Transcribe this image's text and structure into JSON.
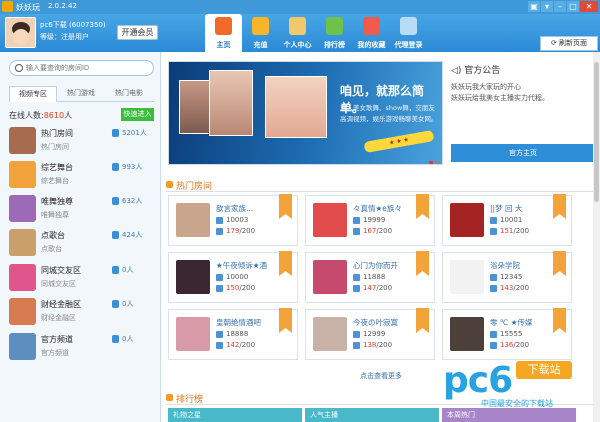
{
  "window": {
    "app_name": "妖妖玩",
    "version": "2.0.2.42"
  },
  "user": {
    "name": "pc6下载 (6007350)",
    "level": "等级：注册用户",
    "vip_button": "开通会员"
  },
  "nav": [
    {
      "label": "主页",
      "icon": "home-icon",
      "color": "#f26a2a"
    },
    {
      "label": "充值",
      "icon": "coins-icon",
      "color": "#f6b52b"
    },
    {
      "label": "个人中心",
      "icon": "person-icon",
      "color": "#f2c86a"
    },
    {
      "label": "排行榜",
      "icon": "bar-chart-icon",
      "color": "#6cc24a"
    },
    {
      "label": "我的收藏",
      "icon": "heart-icon",
      "color": "#ef5c4c"
    },
    {
      "label": "代理登录",
      "icon": "monitor-icon",
      "color": "#b9dcf4"
    }
  ],
  "refresh_label": "刷新页面",
  "search": {
    "placeholder": "输入要查询的房间ID"
  },
  "tabs": [
    "视频专区",
    "热门游戏",
    "热门电影"
  ],
  "online": {
    "label": "在线人数:",
    "count": "8610",
    "unit": "人"
  },
  "quick_enter": "快速进入",
  "categories": [
    {
      "name": "热门房间",
      "sub": "热门房间",
      "count": "5201人",
      "color": "#a56c4f"
    },
    {
      "name": "综艺舞台",
      "sub": "综艺舞台",
      "count": "993人",
      "color": "#f2a23a"
    },
    {
      "name": "唯舞独尊",
      "sub": "唯舞独尊",
      "count": "632人",
      "color": "#9d6ab8"
    },
    {
      "name": "点歌台",
      "sub": "点歌台",
      "count": "424人",
      "color": "#caa06a"
    },
    {
      "name": "同城交友区",
      "sub": "同城交友区",
      "count": "0人",
      "color": "#e0568c"
    },
    {
      "name": "财经金融区",
      "sub": "财经金融区",
      "count": "0人",
      "color": "#d77b52"
    },
    {
      "name": "官方频道",
      "sub": "官方频道",
      "count": "0人",
      "color": "#5c8fbf"
    }
  ],
  "banner": {
    "headline": "咱见，就那么简单。",
    "sub": "真人美女歌舞、show舞，交朋友高调视频，娱乐游戏畅聊美女网。"
  },
  "notice": {
    "title": "官方公告",
    "line1": "妖妖玩我大家玩的开心",
    "line2": "妖妖玩给我美女主播实力代程。",
    "button": "官方主页"
  },
  "hot_title": "热门房间",
  "rooms": [
    {
      "name": "歆言家族...",
      "id": "10003",
      "online": "179",
      "cap": "/200",
      "color": "#c9a58e"
    },
    {
      "name": "々真情★e族々",
      "id": "19999",
      "online": "167",
      "cap": "/200",
      "color": "#e24b4b"
    },
    {
      "name": "||梦 回 大",
      "id": "10001",
      "online": "151",
      "cap": "/200",
      "color": "#a42323"
    },
    {
      "name": "★午夜倾诉★酒",
      "id": "10000",
      "online": "150",
      "cap": "/200",
      "color": "#3a2730"
    },
    {
      "name": "心门为你而开",
      "id": "11888",
      "online": "147",
      "cap": "/200",
      "color": "#c64a6e"
    },
    {
      "name": "浴朵学院",
      "id": "12345",
      "online": "143",
      "cap": "/200",
      "color": "#f2f2f2"
    },
    {
      "name": "皇朝绝情酒吧",
      "id": "18888",
      "online": "142",
      "cap": "/200",
      "color": "#d79aa6"
    },
    {
      "name": "今夜の叶寂寞",
      "id": "12999",
      "online": "138",
      "cap": "/200",
      "color": "#c8b2a7"
    },
    {
      "name": "零 ℃ ★传媒",
      "id": "15555",
      "online": "136",
      "cap": "/200",
      "color": "#4d3f3a"
    }
  ],
  "more": "点击查看更多",
  "rank_title": "排行榜",
  "rank_tabs": [
    {
      "label": "礼物之星",
      "color": "#49b8c8"
    },
    {
      "label": "人气主播",
      "color": "#49b8c8"
    },
    {
      "label": "本周热门",
      "color": "#a884c9"
    }
  ],
  "watermark": {
    "brand": "pc6",
    "tag": "下载站",
    "slogan": "中国最安全的下载站"
  }
}
